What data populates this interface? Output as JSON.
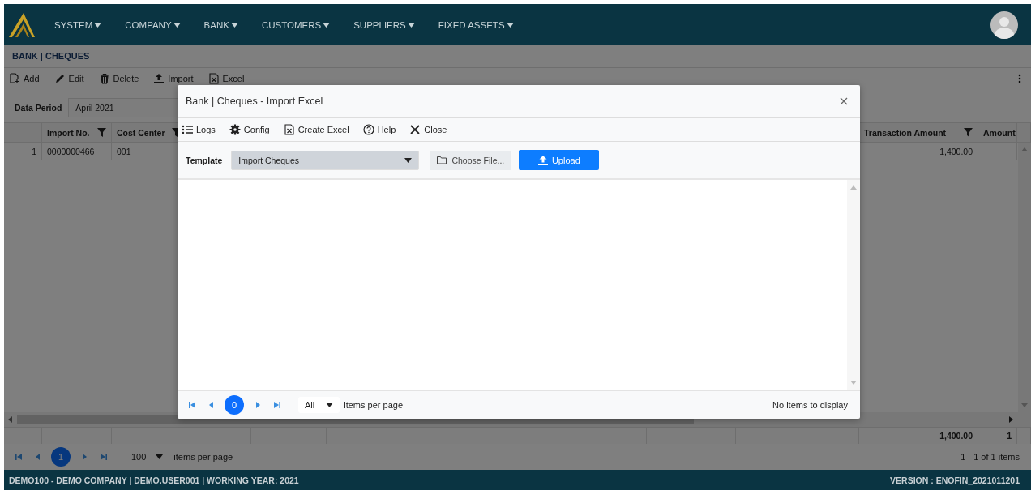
{
  "nav": {
    "menus": [
      {
        "label": "SYSTEM"
      },
      {
        "label": "COMPANY"
      },
      {
        "label": "BANK"
      },
      {
        "label": "CUSTOMERS"
      },
      {
        "label": "SUPPLIERS"
      },
      {
        "label": "FIXED ASSETS"
      }
    ]
  },
  "page_title": "BANK | CHEQUES",
  "toolbar": [
    {
      "kind": "add",
      "label": "Add"
    },
    {
      "kind": "edit",
      "label": "Edit"
    },
    {
      "kind": "delete",
      "label": "Delete"
    },
    {
      "kind": "import",
      "label": "Import"
    },
    {
      "kind": "excel",
      "label": "Excel"
    }
  ],
  "data_period": {
    "label": "Data Period",
    "value": "April 2021"
  },
  "grid": {
    "columns": [
      {
        "filter": false
      },
      {
        "label": "Import No.",
        "filter": true
      },
      {
        "label": "Cost Center",
        "filter": true
      },
      null,
      null,
      null,
      null,
      null,
      {
        "label": "Transaction Amount",
        "filter": true
      },
      {
        "label": "Amount",
        "filter": false
      }
    ],
    "rows": [
      [
        "1",
        "0000000466",
        "001",
        null,
        null,
        null,
        null,
        null,
        "1,400.00",
        null
      ]
    ],
    "totals": {
      "transaction_amount": "1,400.00",
      "amount": "1"
    },
    "pager": {
      "page": "1",
      "page_size": "100",
      "per_page_label": "items per page",
      "summary": "1 - 1 of 1 items"
    }
  },
  "status_bar": {
    "left": "DEMO100 - DEMO COMPANY | DEMO.USER001 | WORKING YEAR: 2021",
    "right": "VERSION : ENOFIN_2021011201"
  },
  "dialog": {
    "title": "Bank | Cheques - Import Excel",
    "toolbar": [
      {
        "kind": "logs",
        "label": "Logs"
      },
      {
        "kind": "config",
        "label": "Config"
      },
      {
        "kind": "excel",
        "label": "Create Excel"
      },
      {
        "kind": "help",
        "label": "Help"
      },
      {
        "kind": "close",
        "label": "Close"
      }
    ],
    "template_label": "Template",
    "template_value": "Import Cheques",
    "choose_file": "Choose File...",
    "upload": "Upload",
    "pager": {
      "page": "0",
      "page_size": "All",
      "per_page_label": "items per page",
      "summary": "No items to display"
    }
  }
}
